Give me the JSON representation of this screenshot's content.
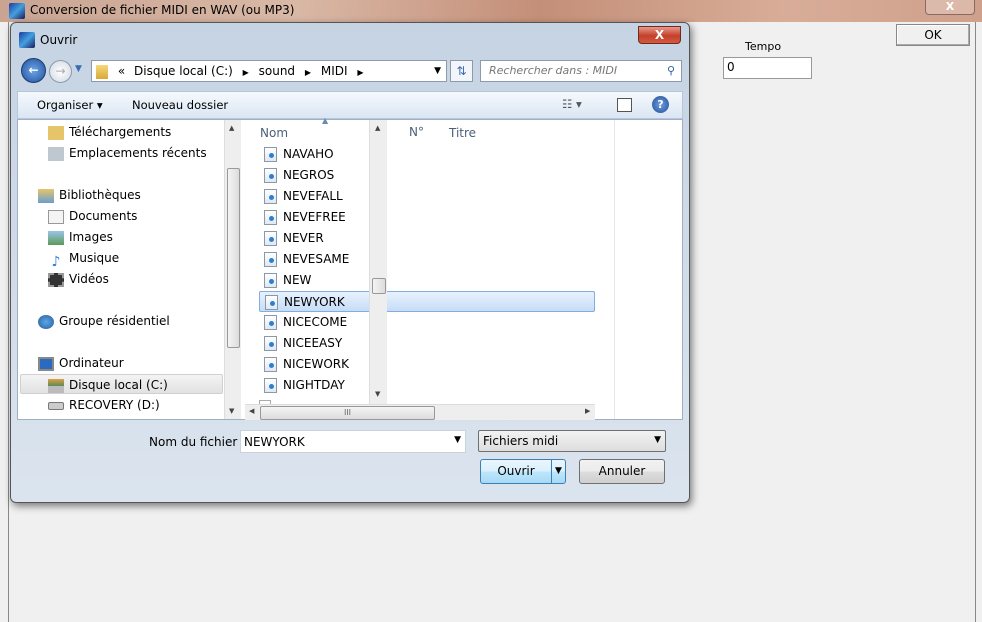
{
  "app": {
    "title": "Conversion de fichier MIDI en WAV (ou MP3)",
    "close": "X",
    "ok_label": "OK",
    "tempo_label": "Tempo",
    "tempo_value": "0"
  },
  "dialog": {
    "title": "Ouvrir",
    "close": "X",
    "breadcrumb": {
      "overflow": "«",
      "parts": [
        "Disque local (C:)",
        "sound",
        "MIDI"
      ]
    },
    "search_placeholder": "Rechercher dans : MIDI",
    "toolbar": {
      "organize": "Organiser ▾",
      "new_folder": "Nouveau dossier"
    },
    "nav": [
      {
        "label": "Téléchargements",
        "icon": "downloads-folder-icon"
      },
      {
        "label": "Emplacements récents",
        "icon": "recent-places-icon"
      },
      {
        "label": "Bibliothèques",
        "icon": "libraries-icon"
      },
      {
        "label": "Documents",
        "icon": "documents-icon"
      },
      {
        "label": "Images",
        "icon": "pictures-icon"
      },
      {
        "label": "Musique",
        "icon": "music-icon"
      },
      {
        "label": "Vidéos",
        "icon": "videos-icon"
      },
      {
        "label": "Groupe résidentiel",
        "icon": "homegroup-icon"
      },
      {
        "label": "Ordinateur",
        "icon": "computer-icon"
      },
      {
        "label": "Disque local (C:)",
        "icon": "drive-icon"
      },
      {
        "label": "RECOVERY (D:)",
        "icon": "drive-icon"
      }
    ],
    "columns": [
      "Nom",
      "N°",
      "Titre"
    ],
    "files": [
      "NAVAHO",
      "NEGROS",
      "NEVEFALL",
      "NEVEFREE",
      "NEVER",
      "NEVESAME",
      "NEW",
      "NEWYORK",
      "NICECOME",
      "NICEEASY",
      "NICEWORK",
      "NIGHTDAY"
    ],
    "selected_file": "NEWYORK",
    "filename_label": "Nom du fichier :",
    "filename_value": "NEWYORK",
    "filetype": "Fichiers midi",
    "open_label": "Ouvrir",
    "cancel_label": "Annuler"
  }
}
